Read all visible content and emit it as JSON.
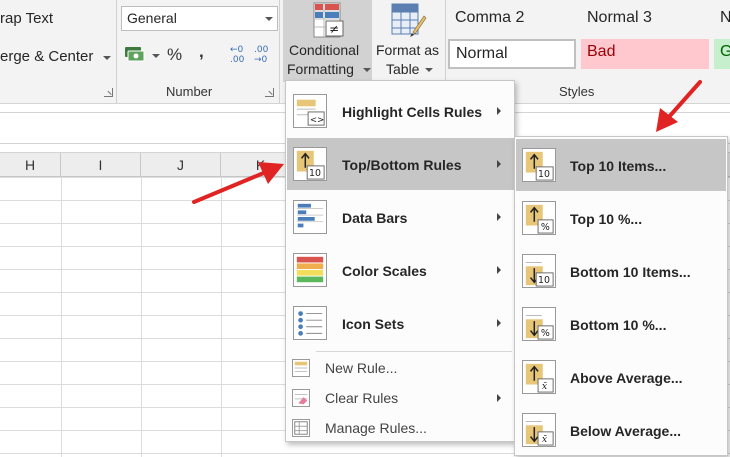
{
  "ribbon": {
    "wrap_text": "rap Text",
    "merge_center": "erge & Center",
    "number_format": "General",
    "percent_symbol": "%",
    "comma_symbol": ",",
    "number_group_label": "Number",
    "conditional_formatting_line1": "Conditional",
    "conditional_formatting_line2": "Formatting",
    "format_as_table_line1": "Format as",
    "format_as_table_line2": "Table",
    "styles_group_label": "Styles",
    "styles": {
      "comma2": "Comma 2",
      "normal3": "Normal 3",
      "partial_n": "N",
      "normal": "Normal",
      "bad": "Bad",
      "partial_g": "G"
    },
    "colors": {
      "bad_bg": "#ffc7ce",
      "bad_text": "#9c0006",
      "good_bg": "#c6efce",
      "good_text": "#006100",
      "active_button": "#d2d2d2"
    }
  },
  "columns": [
    "H",
    "I",
    "J",
    "K"
  ],
  "cf_menu": {
    "items": [
      {
        "label": "Highlight Cells Rules",
        "icon": "highlight-cells-icon"
      },
      {
        "label": "Top/Bottom Rules",
        "icon": "top-bottom-icon"
      },
      {
        "label": "Data Bars",
        "icon": "data-bars-icon"
      },
      {
        "label": "Color Scales",
        "icon": "color-scales-icon"
      },
      {
        "label": "Icon Sets",
        "icon": "icon-sets-icon"
      }
    ],
    "small_items": [
      {
        "label": "New Rule...",
        "icon": "new-rule-icon"
      },
      {
        "label": "Clear Rules",
        "icon": "clear-rules-icon"
      },
      {
        "label": "Manage Rules...",
        "icon": "manage-rules-icon"
      }
    ]
  },
  "topbottom_menu": {
    "items": [
      {
        "label": "Top 10 Items...",
        "icon_badge": "10"
      },
      {
        "label": "Top 10 %...",
        "icon_badge": "%"
      },
      {
        "label": "Bottom 10 Items...",
        "icon_badge": "10"
      },
      {
        "label": "Bottom 10 %...",
        "icon_badge": "%"
      },
      {
        "label": "Above Average...",
        "icon_badge": "x̄"
      },
      {
        "label": "Below Average...",
        "icon_badge": "x̄"
      }
    ]
  },
  "annotation_color": "#e02424"
}
